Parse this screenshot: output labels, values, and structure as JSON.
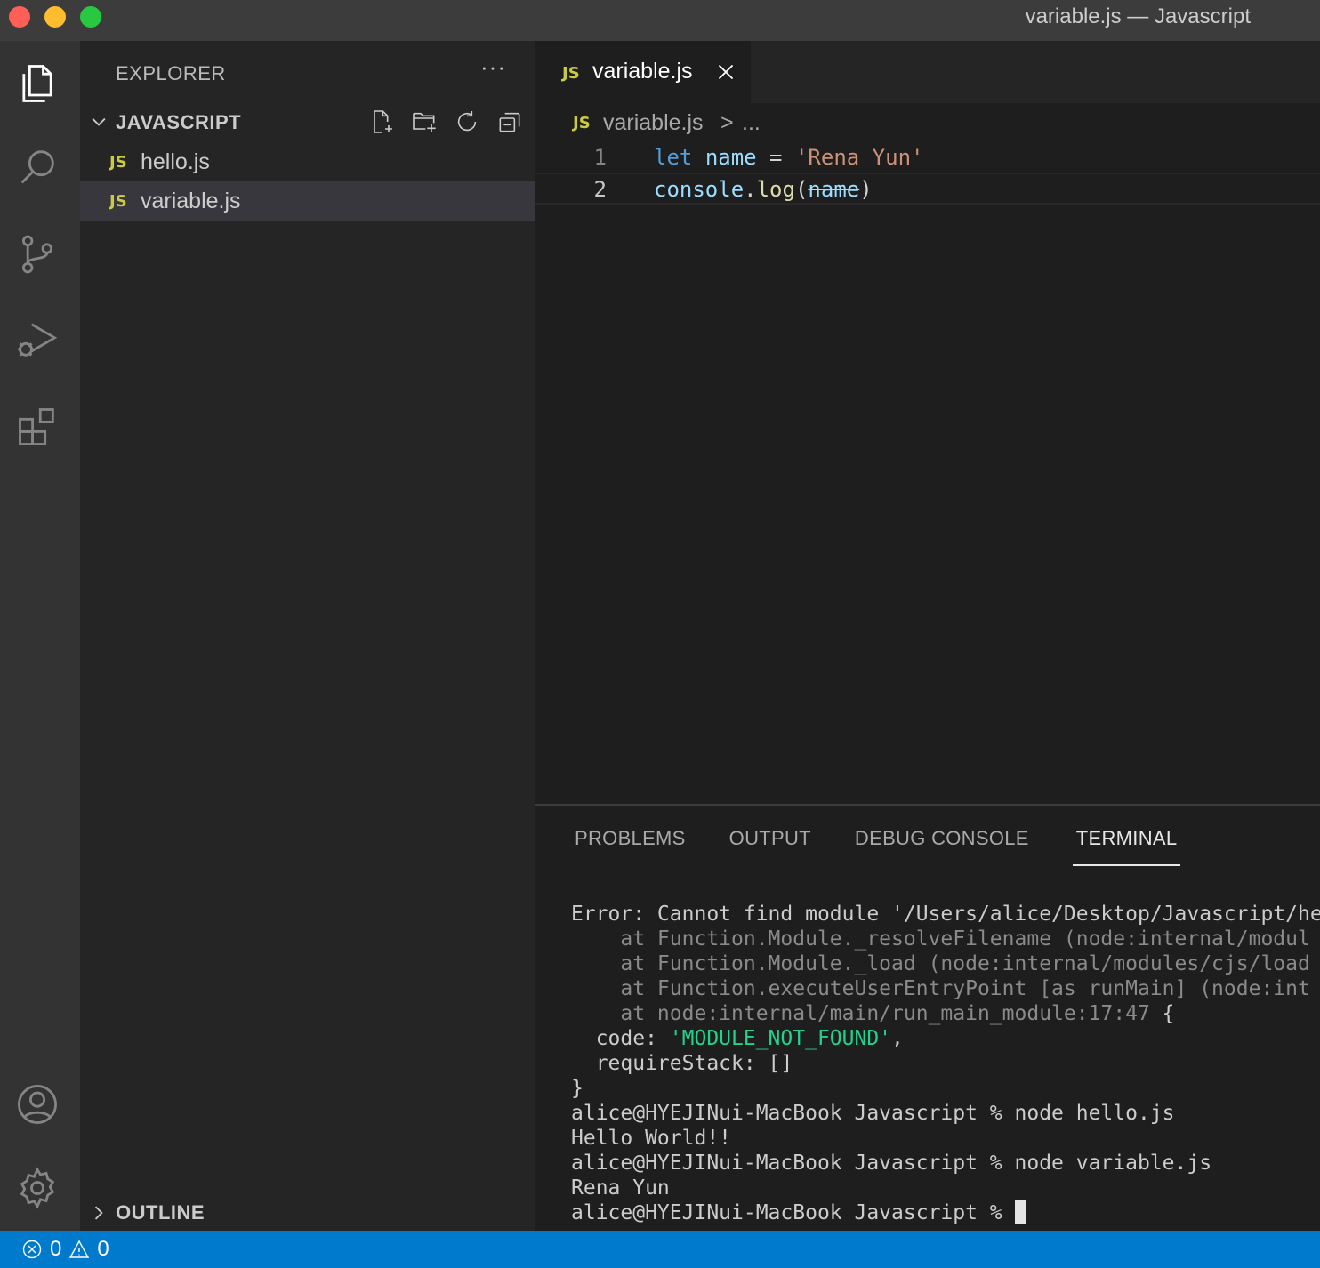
{
  "window": {
    "title": "variable.js — Javascript"
  },
  "sidebar": {
    "header": "EXPLORER",
    "more": "···",
    "folder": "JAVASCRIPT",
    "files": [
      {
        "badge": "JS",
        "name": "hello.js"
      },
      {
        "badge": "JS",
        "name": "variable.js"
      }
    ],
    "outline": "OUTLINE"
  },
  "editor": {
    "tab": {
      "badge": "JS",
      "name": "variable.js"
    },
    "breadcrumb": {
      "badge": "JS",
      "file": "variable.js",
      "sep": ">",
      "more": "..."
    },
    "lines": [
      {
        "num": "1",
        "kw": "let",
        "var": "name",
        "op": " = ",
        "str": "'Rena Yun'"
      },
      {
        "num": "2",
        "obj": "console",
        "dot": ".",
        "fn": "log",
        "open": "(",
        "arg": "name",
        "close": ")"
      }
    ]
  },
  "panel": {
    "tabs": [
      "PROBLEMS",
      "OUTPUT",
      "DEBUG CONSOLE",
      "TERMINAL"
    ],
    "terminal": {
      "l1": "Error: Cannot find module '/Users/alice/Desktop/Javascript/he",
      "l2": "    at Function.Module._resolveFilename (node:internal/modul",
      "l3": "    at Function.Module._load (node:internal/modules/cjs/load",
      "l4": "    at Function.executeUserEntryPoint [as runMain] (node:int",
      "l5a": "    at node:internal/main/run_main_module:17:47",
      "l5b": " {",
      "l6a": "  code: ",
      "l6b": "'MODULE_NOT_FOUND'",
      "l6c": ",",
      "l7": "  requireStack: []",
      "l8": "}",
      "l9": "alice@HYEJINui-MacBook Javascript % node hello.js",
      "l10": "Hello World!!",
      "l11": "alice@HYEJINui-MacBook Javascript % node variable.js",
      "l12": "Rena Yun",
      "l13": "alice@HYEJINui-MacBook Javascript % "
    }
  },
  "statusbar": {
    "errors": "0",
    "warnings": "0"
  },
  "colors": {
    "accent": "#007acc",
    "js_badge": "#cbcb41",
    "string": "#ce9178",
    "keyword": "#569cd6",
    "function": "#dcdcaa",
    "variable": "#9cdcfe",
    "terminal_green": "#23d18b"
  }
}
